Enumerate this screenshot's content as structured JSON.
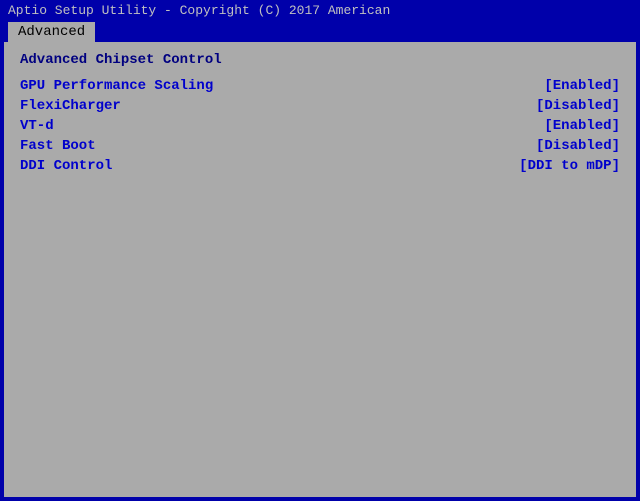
{
  "topbar": {
    "title": "Aptio Setup Utility - Copyright (C) 2017 American",
    "right": ""
  },
  "tabs": [
    {
      "label": "Advanced",
      "active": true
    }
  ],
  "section": {
    "title": "Advanced Chipset Control"
  },
  "settings": [
    {
      "label": "GPU Performance Scaling",
      "value": "[Enabled]"
    },
    {
      "label": "FlexiCharger",
      "value": "[Disabled]"
    },
    {
      "label": "VT-d",
      "value": "[Enabled]"
    },
    {
      "label": "Fast Boot",
      "value": "[Disabled]"
    },
    {
      "label": "DDI Control",
      "value": "[DDI to mDP]"
    }
  ]
}
